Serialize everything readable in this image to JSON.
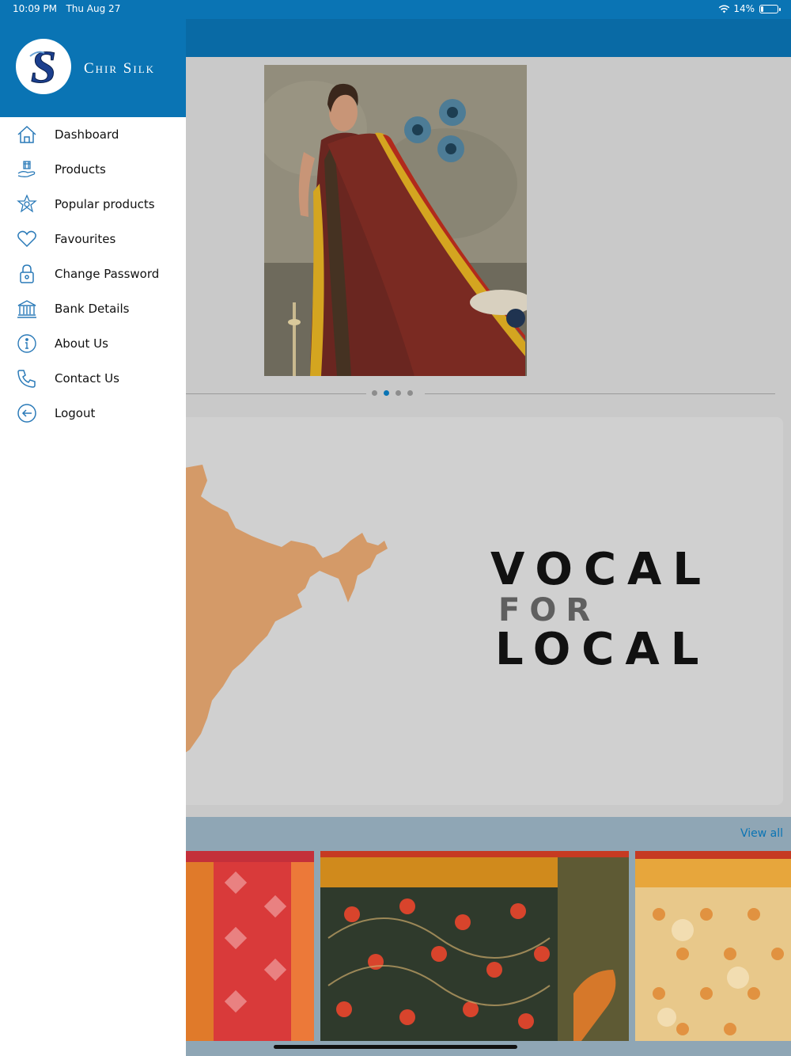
{
  "status_bar": {
    "time": "10:09 PM",
    "date": "Thu Aug 27",
    "battery": "14%",
    "battery_level": 0.14
  },
  "brand": {
    "name": "Chir Silk",
    "logo_letter": "S"
  },
  "menu": [
    {
      "label": "Dashboard",
      "icon": "home-icon"
    },
    {
      "label": "Products",
      "icon": "products-icon"
    },
    {
      "label": "Popular products",
      "icon": "popular-icon"
    },
    {
      "label": "Favourites",
      "icon": "heart-icon"
    },
    {
      "label": "Change Password",
      "icon": "lock-icon"
    },
    {
      "label": "Bank Details",
      "icon": "bank-icon"
    },
    {
      "label": "About Us",
      "icon": "info-icon"
    },
    {
      "label": "Contact Us",
      "icon": "phone-icon"
    },
    {
      "label": "Logout",
      "icon": "logout-icon"
    }
  ],
  "carousel": {
    "page_count": 4,
    "active_index": 1
  },
  "vocal_banner": {
    "line1": "VOCAL",
    "line2": "FOR",
    "line3": "LOCAL"
  },
  "product_section": {
    "view_all": "View all"
  },
  "colors": {
    "primary": "#0a74b4",
    "app_bar": "#096aa5",
    "content_bg": "#c9c9c9",
    "map": "#d49a68",
    "strip": "#8fa6b5"
  }
}
